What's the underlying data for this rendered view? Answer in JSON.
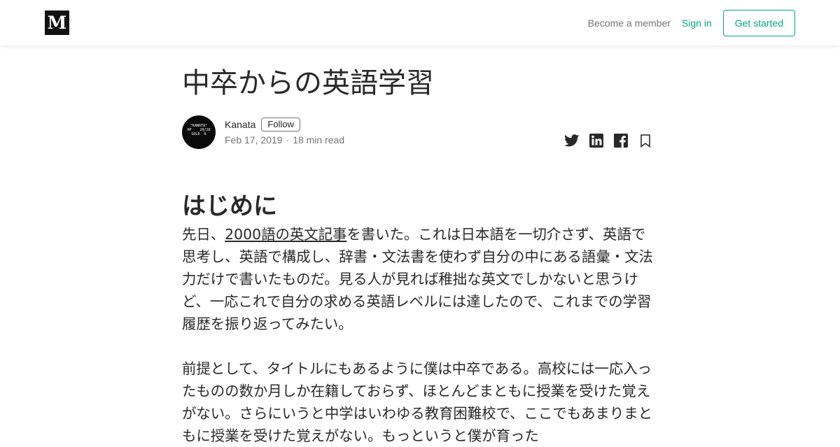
{
  "header": {
    "logo_letter": "M",
    "become_member": "Become a member",
    "sign_in": "Sign in",
    "get_started": "Get started"
  },
  "article": {
    "title": "中卒からの英語学習",
    "author": {
      "name": "Kanata",
      "follow_label": "Follow",
      "avatar_lines": [
        "\"KANATA\"",
        "HP    20/20",
        "GOLD  0"
      ]
    },
    "date": "Feb 17, 2019",
    "separator": "·",
    "read_time": "18 min read",
    "share_icons": [
      "twitter-icon",
      "linkedin-icon",
      "facebook-icon",
      "bookmark-icon"
    ],
    "section_heading": "はじめに",
    "paragraph1": {
      "before_link": "先日、",
      "link_text": "2000語の英文記事",
      "after_link": "を書いた。これは日本語を一切介さず、英語で思考し、英語で構成し、辞書・文法書を使わず自分の中にある語彙・文法力だけで書いたものだ。見る人が見れば稚拙な英文でしかないと思うけど、一応これで自分の求める英語レベルには達したので、これまでの学習履歴を振り返ってみたい。"
    },
    "paragraph2": "前提として、タイトルにもあるように僕は中卒である。高校には一応入ったものの数か月しか在籍しておらず、ほとんどまともに授業を受けた覚えがない。さらにいうと中学はいわゆる教育困難校で、ここでもあまりまともに授業を受けた覚えがない。もっというと僕が育った"
  },
  "colors": {
    "accent_green": "#03a87c",
    "text_dark": "#292929",
    "text_muted": "#757575",
    "logo_bg": "#121212"
  }
}
